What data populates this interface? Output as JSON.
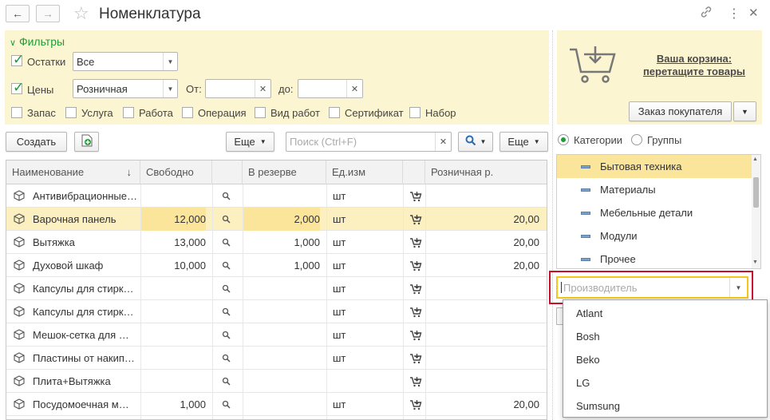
{
  "window": {
    "title": "Номенклатура",
    "back_icon": "arrow-left-icon",
    "forward_icon": "arrow-right-icon",
    "link_icon": "link-icon",
    "more_icon": "more-vert-icon",
    "close_icon": "close-icon"
  },
  "filters": {
    "header": "Фильтры",
    "ostatki": {
      "label": "Остатки",
      "checked": true,
      "value": "Все"
    },
    "ceny": {
      "label": "Цены",
      "checked": true,
      "value": "Розничная"
    },
    "from_label": "От:",
    "to_label": "до:",
    "from_value": "",
    "to_value": "",
    "types": [
      {
        "label": "Запас",
        "checked": false
      },
      {
        "label": "Услуга",
        "checked": false
      },
      {
        "label": "Работа",
        "checked": false
      },
      {
        "label": "Операция",
        "checked": false
      },
      {
        "label": "Вид работ",
        "checked": false
      },
      {
        "label": "Сертификат",
        "checked": false
      },
      {
        "label": "Набор",
        "checked": false
      }
    ]
  },
  "cart": {
    "line1": "Ваша корзина:",
    "line2": "перетащите товары",
    "order_button": "Заказ покупателя"
  },
  "toolbar": {
    "create": "Создать",
    "more1": "Еще",
    "search_placeholder": "Поиск (Ctrl+F)",
    "more2": "Еще"
  },
  "table": {
    "columns": [
      "Наименование",
      "Свободно",
      "В резерве",
      "Ед.изм",
      "Розничная р."
    ],
    "sort_indicator": "↓",
    "rows": [
      {
        "name": "Антивибрационные…",
        "free": "",
        "reserve": "",
        "unit": "шт",
        "price": ""
      },
      {
        "name": "Варочная панель",
        "free": "12,000",
        "reserve": "2,000",
        "unit": "шт",
        "price": "20,00"
      },
      {
        "name": "Вытяжка",
        "free": "13,000",
        "reserve": "1,000",
        "unit": "шт",
        "price": "20,00"
      },
      {
        "name": "Духовой шкаф",
        "free": "10,000",
        "reserve": "1,000",
        "unit": "шт",
        "price": "20,00"
      },
      {
        "name": "Капсулы для стирк…",
        "free": "",
        "reserve": "",
        "unit": "шт",
        "price": ""
      },
      {
        "name": "Капсулы для стирк…",
        "free": "",
        "reserve": "",
        "unit": "шт",
        "price": ""
      },
      {
        "name": "Мешок-сетка для …",
        "free": "",
        "reserve": "",
        "unit": "шт",
        "price": ""
      },
      {
        "name": "Пластины от накип…",
        "free": "",
        "reserve": "",
        "unit": "шт",
        "price": ""
      },
      {
        "name": "Плита+Вытяжка",
        "free": "",
        "reserve": "",
        "unit": "",
        "price": ""
      },
      {
        "name": "Посудомоечная м…",
        "free": "1,000",
        "reserve": "",
        "unit": "шт",
        "price": "20,00"
      }
    ]
  },
  "view": {
    "categories": "Категории",
    "groups": "Группы"
  },
  "tree": {
    "items": [
      "Бытовая техника",
      "Материалы",
      "Мебельные детали",
      "Модули",
      "Прочее"
    ]
  },
  "manufacturer": {
    "placeholder": "Производитель",
    "options": [
      "Atlant",
      "Bosh",
      "Beko",
      "LG",
      "Sumsung"
    ]
  },
  "colors": {
    "accent_green": "#1a9e35",
    "filter_bg": "#fcf5d1",
    "selected_row": "#fcefc0",
    "highlight_red": "#c8102e",
    "field_yellow": "#f5c518"
  }
}
